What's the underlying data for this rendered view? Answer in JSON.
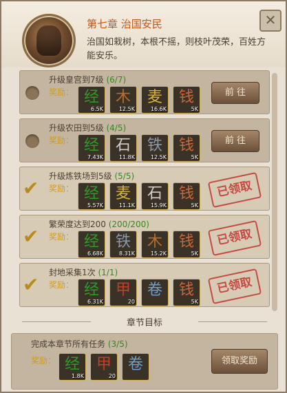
{
  "header": {
    "chapter_title": "第七章 治国安民",
    "description": "治国如栽树，本根不摇，则枝叶茂荣，百姓方能安乐。"
  },
  "close_icon": "✕",
  "reward_label": "奖励：",
  "goto_label": "前 往",
  "claimed_label": "已领取",
  "tasks": [
    {
      "name": "升级皇宫到7级",
      "progress": "(6/7)",
      "done": false,
      "rewards": [
        {
          "icon": "经",
          "count": "6.5K"
        },
        {
          "icon": "木",
          "count": "12.5K"
        },
        {
          "icon": "麦",
          "count": "16.6K"
        },
        {
          "icon": "钱",
          "count": "5K"
        }
      ]
    },
    {
      "name": "升级农田到5级",
      "progress": "(4/5)",
      "done": false,
      "rewards": [
        {
          "icon": "经",
          "count": "7.43K"
        },
        {
          "icon": "石",
          "count": "11.8K"
        },
        {
          "icon": "铁",
          "count": "12.5K"
        },
        {
          "icon": "钱",
          "count": "5K"
        }
      ]
    },
    {
      "name": "升级炼铁场到5级",
      "progress": "(5/5)",
      "done": true,
      "rewards": [
        {
          "icon": "经",
          "count": "5.57K"
        },
        {
          "icon": "麦",
          "count": "11.1K"
        },
        {
          "icon": "石",
          "count": "15.9K"
        },
        {
          "icon": "钱",
          "count": "5K"
        }
      ]
    },
    {
      "name": "繁荣度达到200",
      "progress": "(200/200)",
      "done": true,
      "rewards": [
        {
          "icon": "经",
          "count": "6.68K"
        },
        {
          "icon": "铁",
          "count": "8.31K"
        },
        {
          "icon": "木",
          "count": "15.2K"
        },
        {
          "icon": "钱",
          "count": "5K"
        }
      ]
    },
    {
      "name": "封地采集1次",
      "progress": "(1/1)",
      "done": true,
      "rewards": [
        {
          "icon": "经",
          "count": "6.31K"
        },
        {
          "icon": "甲",
          "count": "20"
        },
        {
          "icon": "卷",
          "count": ""
        },
        {
          "icon": "钱",
          "count": "5K"
        }
      ]
    }
  ],
  "section_title": "章节目标",
  "chapter_goal": {
    "name": "完成本章节所有任务",
    "progress": "(3/5)",
    "rewards": [
      {
        "icon": "经",
        "count": "1.8K"
      },
      {
        "icon": "甲",
        "count": "20"
      },
      {
        "icon": "卷",
        "count": ""
      }
    ],
    "claim_button": "领取奖励"
  },
  "colors": {
    "title": "#c4561c",
    "progress": "#2e8a1d",
    "reward": "#d19b1a",
    "stamp": "#c0342d"
  }
}
